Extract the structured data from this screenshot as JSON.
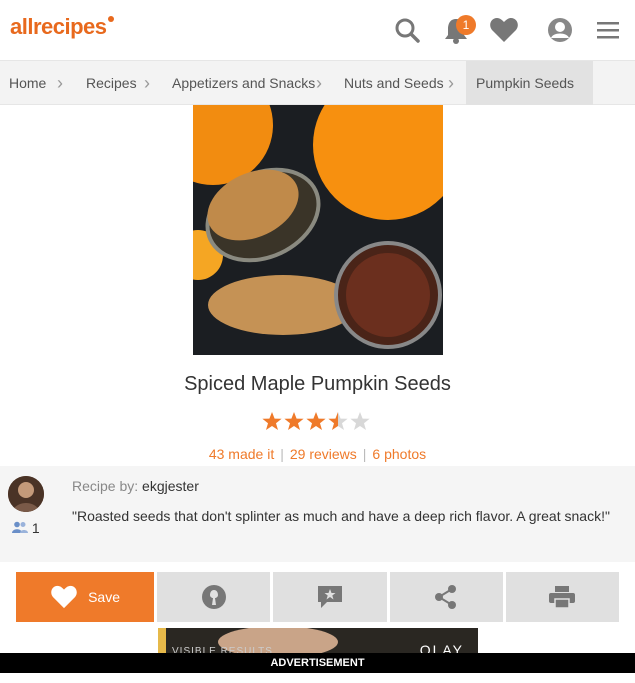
{
  "header": {
    "logo": "allrecipes",
    "notification_count": "1"
  },
  "breadcrumb": [
    "Home",
    "Recipes",
    "Appetizers and Snacks",
    "Nuts and Seeds",
    "Pumpkin Seeds"
  ],
  "recipe": {
    "title": "Spiced Maple Pumpkin Seeds",
    "rating": 3.5,
    "rating_max": 5,
    "made_it": "43 made it",
    "reviews": "29 reviews",
    "photos": "6 photos",
    "by_label": "Recipe by:",
    "author": "ekgjester",
    "followers": "1",
    "description": "\"Roasted seeds that don't splinter as much and have a deep rich flavor. A great snack!\""
  },
  "actions": {
    "save_label": "Save"
  },
  "ad": {
    "text": "VISIBLE RESULTS",
    "brand": "OLAY",
    "bar_label": "ADVERTISEMENT"
  },
  "colors": {
    "accent": "#ef7a2a",
    "star_empty": "#d8d8d8"
  }
}
